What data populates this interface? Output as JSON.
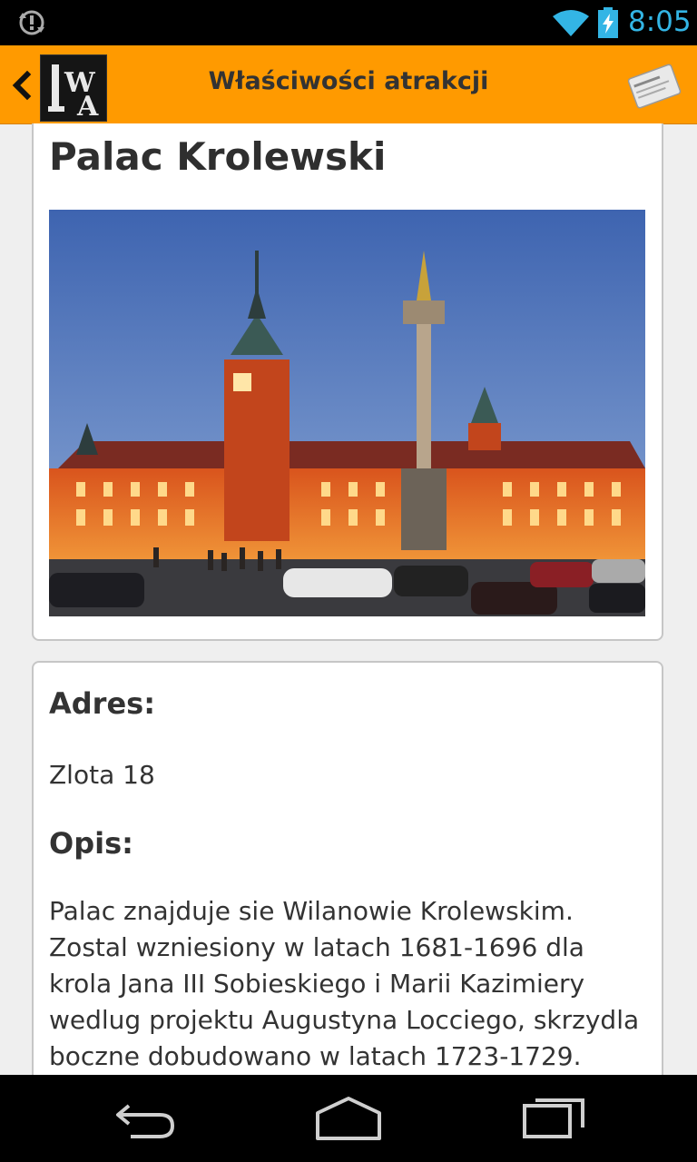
{
  "status_bar": {
    "time": "8:05",
    "icons": [
      "sync-icon",
      "wifi-icon",
      "battery-charging-icon"
    ],
    "accent_color": "#33b5e5"
  },
  "action_bar": {
    "title": "Właściwości atrakcji",
    "logo_text": "WA",
    "background_color": "#ff9a00",
    "icons": [
      "chevron-left-icon",
      "app-logo",
      "card-icon"
    ]
  },
  "attraction": {
    "name": "Palac Krolewski",
    "photo": "royal-castle-photo"
  },
  "details": {
    "address_heading": "Adres:",
    "address_value": "Zlota 18",
    "description_heading": "Opis:",
    "description_lines": [
      "Palac znajduje sie Wilanowie Krolewskim.",
      "Zostal wzniesiony w latach 1681-1696 dla",
      "krola Jana III Sobieskiego i Marii Kazimiery",
      "wedlug projektu Augustyna Locciego, skrzydla",
      "boczne dobudowano w latach 1723-1729."
    ]
  },
  "nav_bar": {
    "icons": [
      "back-arrow-icon",
      "home-icon",
      "recent-apps-icon"
    ]
  }
}
